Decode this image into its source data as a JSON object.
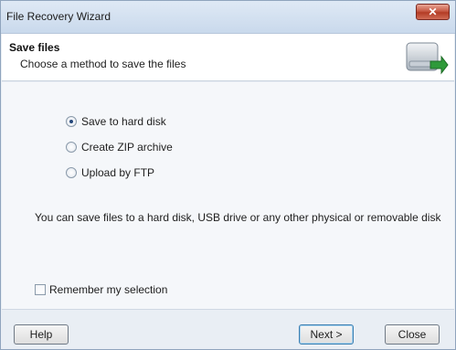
{
  "window": {
    "title": "File Recovery Wizard"
  },
  "header": {
    "title": "Save files",
    "subtitle": "Choose a method to save the files",
    "icon": "hard-disk-export-icon"
  },
  "options": [
    {
      "label": "Save to hard disk",
      "checked": true
    },
    {
      "label": "Create ZIP archive",
      "checked": false
    },
    {
      "label": "Upload by FTP",
      "checked": false
    }
  ],
  "info": "You can save files to a hard disk, USB drive or any other physical or removable disk",
  "remember": {
    "label": "Remember my selection",
    "checked": false
  },
  "buttons": {
    "help": "Help",
    "next": "Next >",
    "close": "Close"
  },
  "colors": {
    "title_bar": "#c9d9ec",
    "close_button": "#c75a45",
    "accent": "#3c7fb1"
  }
}
